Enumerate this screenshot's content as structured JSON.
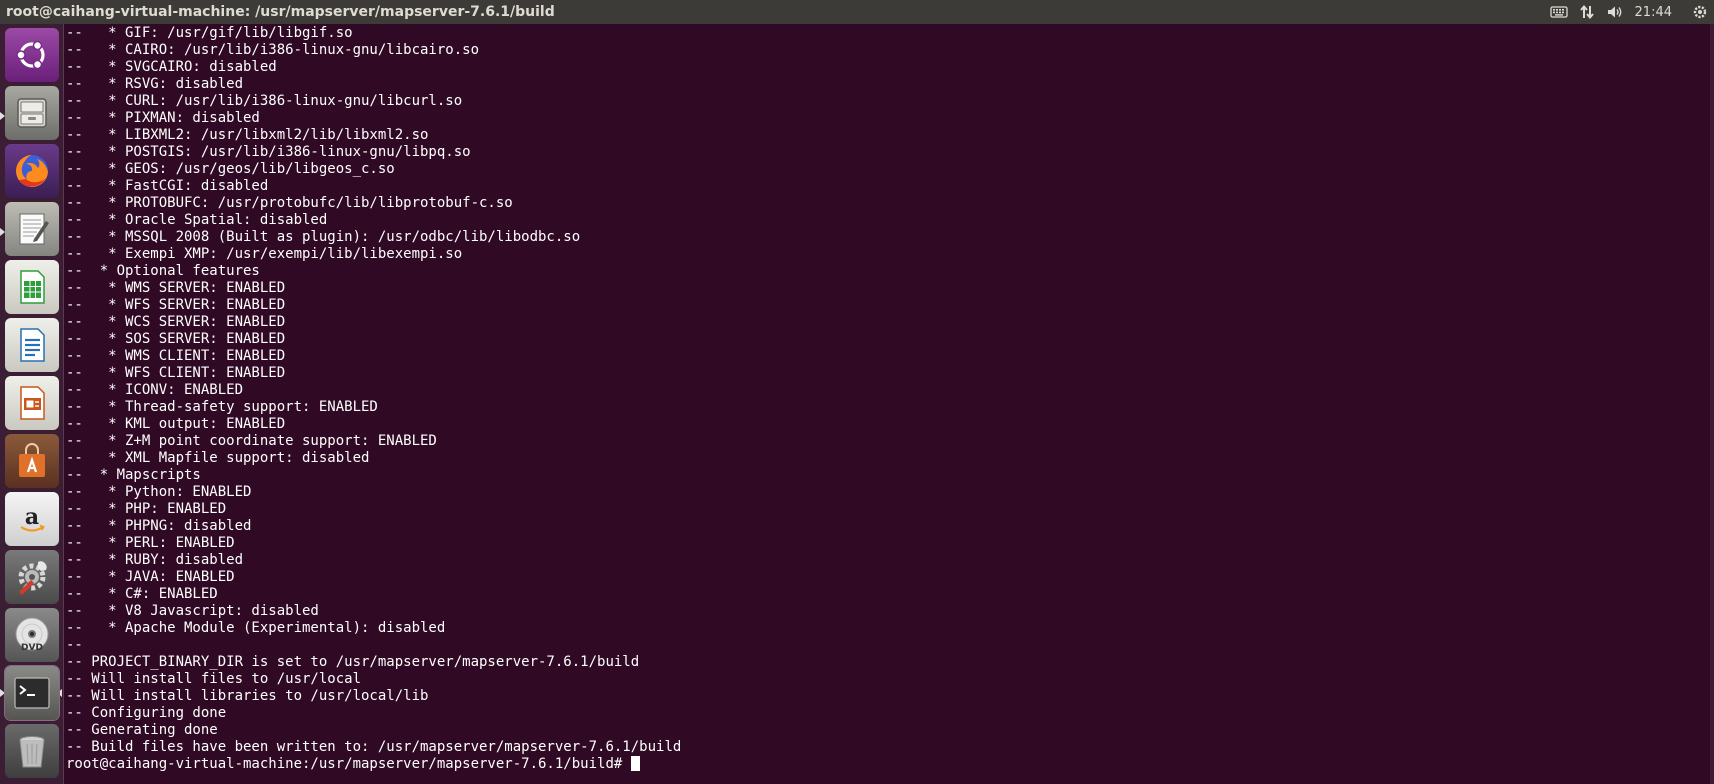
{
  "window": {
    "title": "root@caihang-virtual-machine: /usr/mapserver/mapserver-7.6.1/build"
  },
  "indicators": {
    "clock": "21:44",
    "icons": [
      "keyboard-icon",
      "network-arrows-icon",
      "volume-icon",
      "power-gear-icon"
    ]
  },
  "launcher": {
    "items": [
      {
        "name": "ubuntu-dash",
        "icon": "ubuntu-logo-icon",
        "color": "#7b2a8a"
      },
      {
        "name": "files",
        "icon": "file-cabinet-icon",
        "color": "#8a8a86"
      },
      {
        "name": "firefox",
        "icon": "firefox-icon",
        "color": "#e66000"
      },
      {
        "name": "text-editor",
        "icon": "notepad-icon",
        "color": "#cfcfc7"
      },
      {
        "name": "libreoffice-calc",
        "icon": "spreadsheet-icon",
        "color": "#2f9e3c"
      },
      {
        "name": "libreoffice-writer",
        "icon": "document-icon",
        "color": "#2a6fb5"
      },
      {
        "name": "libreoffice-impress",
        "icon": "presentation-icon",
        "color": "#c9561c"
      },
      {
        "name": "software-center",
        "icon": "shopping-bag-icon",
        "color": "#e0702a"
      },
      {
        "name": "amazon",
        "icon": "amazon-icon",
        "color": "#e8e8e8"
      },
      {
        "name": "system-settings",
        "icon": "wrench-gear-icon",
        "color": "#9a9a9a"
      },
      {
        "name": "dvd",
        "icon": "dvd-disc-icon",
        "color": "#bdbdbd"
      },
      {
        "name": "terminal",
        "icon": "terminal-icon",
        "color": "#2c2c2c"
      },
      {
        "name": "trash",
        "icon": "trash-icon",
        "color": "#9a9a9a"
      }
    ]
  },
  "terminal": {
    "lines": [
      "--   * GIF: /usr/gif/lib/libgif.so",
      "--   * CAIRO: /usr/lib/i386-linux-gnu/libcairo.so",
      "--   * SVGCAIRO: disabled",
      "--   * RSVG: disabled",
      "--   * CURL: /usr/lib/i386-linux-gnu/libcurl.so",
      "--   * PIXMAN: disabled",
      "--   * LIBXML2: /usr/libxml2/lib/libxml2.so",
      "--   * POSTGIS: /usr/lib/i386-linux-gnu/libpq.so",
      "--   * GEOS: /usr/geos/lib/libgeos_c.so",
      "--   * FastCGI: disabled",
      "--   * PROTOBUFC: /usr/protobufc/lib/libprotobuf-c.so",
      "--   * Oracle Spatial: disabled",
      "--   * MSSQL 2008 (Built as plugin): /usr/odbc/lib/libodbc.so",
      "--   * Exempi XMP: /usr/exempi/lib/libexempi.so",
      "--  * Optional features",
      "--   * WMS SERVER: ENABLED",
      "--   * WFS SERVER: ENABLED",
      "--   * WCS SERVER: ENABLED",
      "--   * SOS SERVER: ENABLED",
      "--   * WMS CLIENT: ENABLED",
      "--   * WFS CLIENT: ENABLED",
      "--   * ICONV: ENABLED",
      "--   * Thread-safety support: ENABLED",
      "--   * KML output: ENABLED",
      "--   * Z+M point coordinate support: ENABLED",
      "--   * XML Mapfile support: disabled",
      "--  * Mapscripts",
      "--   * Python: ENABLED",
      "--   * PHP: ENABLED",
      "--   * PHPNG: disabled",
      "--   * PERL: ENABLED",
      "--   * RUBY: disabled",
      "--   * JAVA: ENABLED",
      "--   * C#: ENABLED",
      "--   * V8 Javascript: disabled",
      "--   * Apache Module (Experimental): disabled",
      "--",
      "-- PROJECT_BINARY_DIR is set to /usr/mapserver/mapserver-7.6.1/build",
      "-- Will install files to /usr/local",
      "-- Will install libraries to /usr/local/lib",
      "-- Configuring done",
      "-- Generating done",
      "-- Build files have been written to: /usr/mapserver/mapserver-7.6.1/build"
    ],
    "prompt": "root@caihang-virtual-machine:/usr/mapserver/mapserver-7.6.1/build#"
  }
}
